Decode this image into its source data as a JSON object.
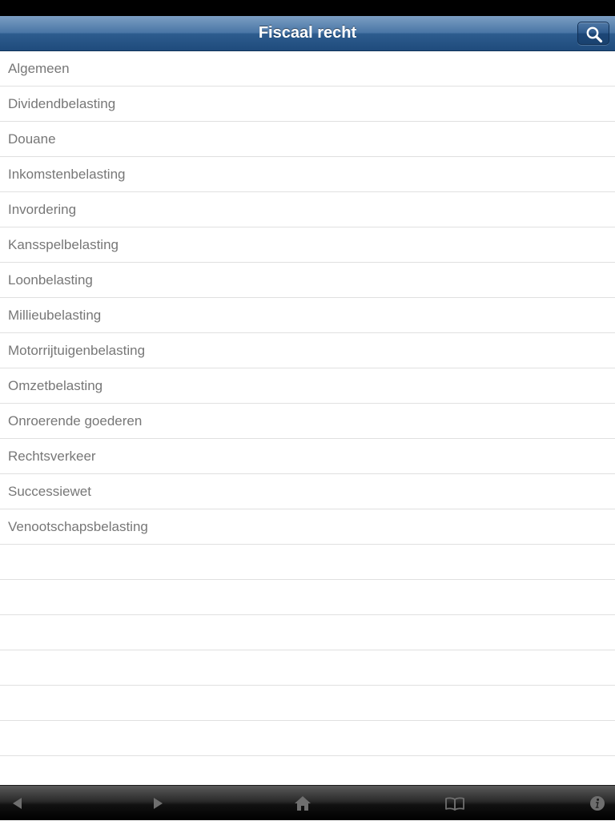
{
  "nav": {
    "title": "Fiscaal recht",
    "search_icon": "search-icon"
  },
  "list": {
    "items": [
      "Algemeen",
      "Dividendbelasting",
      "Douane",
      "Inkomstenbelasting",
      "Invordering",
      "Kansspelbelasting",
      "Loonbelasting",
      "Millieubelasting",
      "Motorrijtuigenbelasting",
      "Omzetbelasting",
      "Onroerende goederen",
      "Rechtsverkeer",
      "Successiewet",
      "Venootschapsbelasting"
    ],
    "empty_rows": 7
  },
  "toolbar": {
    "icons": [
      "back-icon",
      "forward-icon",
      "home-icon",
      "book-icon",
      "info-icon"
    ]
  },
  "colors": {
    "nav_bar": "#2d5c8e",
    "row_text": "#777777",
    "separator": "#e0e0e0",
    "toolbar": "#111111",
    "toolbar_icon": "#6e6e6e"
  }
}
